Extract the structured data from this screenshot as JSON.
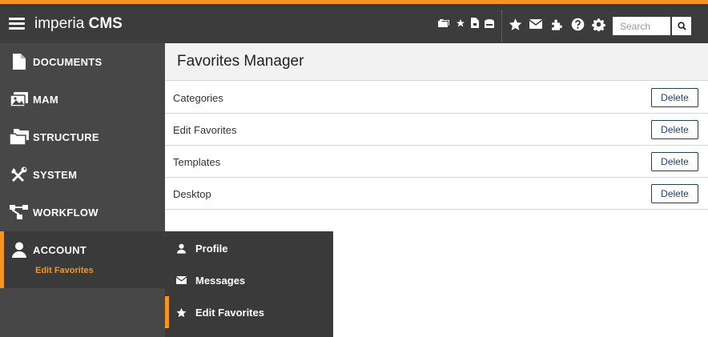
{
  "header": {
    "brand_light": "imperia",
    "brand_bold": "CMS",
    "search_placeholder": "Search"
  },
  "sidebar": {
    "items": [
      {
        "label": "DOCUMENTS",
        "icon": "document-icon"
      },
      {
        "label": "MAM",
        "icon": "images-icon"
      },
      {
        "label": "STRUCTURE",
        "icon": "folders-icon"
      },
      {
        "label": "SYSTEM",
        "icon": "tools-icon"
      },
      {
        "label": "WORKFLOW",
        "icon": "workflow-icon"
      },
      {
        "label": "ACCOUNT",
        "icon": "user-icon",
        "sub": "Edit Favorites"
      }
    ]
  },
  "main": {
    "title": "Favorites Manager",
    "rows": [
      {
        "label": "Categories",
        "action": "Delete"
      },
      {
        "label": "Edit Favorites",
        "action": "Delete"
      },
      {
        "label": "Templates",
        "action": "Delete"
      },
      {
        "label": "Desktop",
        "action": "Delete"
      }
    ]
  },
  "flyout": {
    "items": [
      {
        "label": "Profile",
        "icon": "user-icon"
      },
      {
        "label": "Messages",
        "icon": "envelope-icon"
      },
      {
        "label": "Edit Favorites",
        "icon": "star-icon"
      }
    ]
  },
  "colors": {
    "accent": "#f7941d",
    "header_bg": "#3c3c3c",
    "sidebar_bg": "#474747",
    "button_border": "#1f3f5f"
  }
}
